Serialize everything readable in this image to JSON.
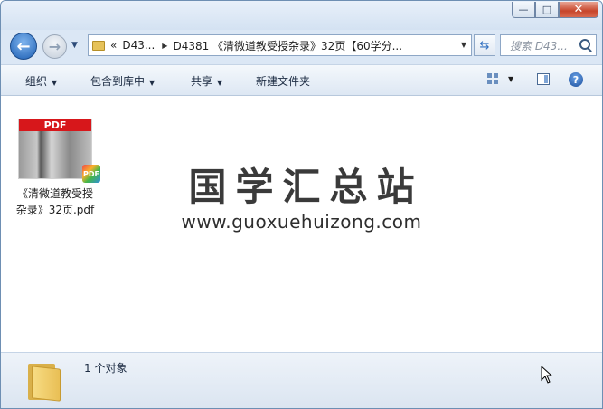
{
  "window": {
    "minimize_glyph": "—",
    "maximize_glyph": "□",
    "close_glyph": "✕"
  },
  "nav": {
    "back_glyph": "←",
    "forward_glyph": "→"
  },
  "address": {
    "overflow": "«",
    "crumb1": "D43...",
    "crumb2": "D4381 《清微道教受授杂录》32页【60学分..."
  },
  "search": {
    "placeholder": "搜索 D43..."
  },
  "toolbar": {
    "organize": "组织",
    "include_library": "包含到库中",
    "share": "共享",
    "new_folder": "新建文件夹"
  },
  "files": [
    {
      "name_line1": "《清微道教受授",
      "name_line2": "杂录》32页.pdf",
      "thumb_band": "PDF",
      "badge": "PDF"
    }
  ],
  "watermark": {
    "title": "国学汇总站",
    "url": "www.guoxuehuizong.com"
  },
  "details": {
    "count_text": "1 个对象"
  },
  "colors": {
    "pdf_red": "#d7171b",
    "chrome_blue": "#dbe7f5",
    "accent": "#1d5fb3"
  }
}
